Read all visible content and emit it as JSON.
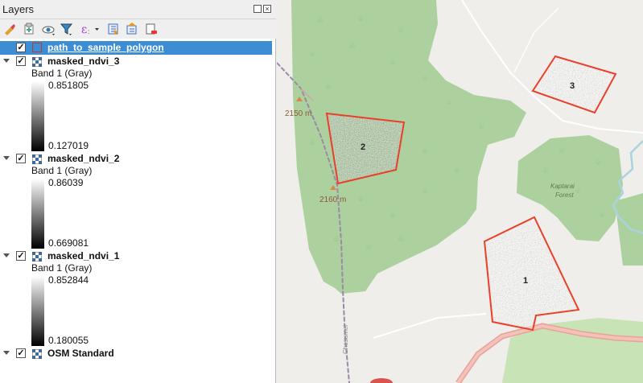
{
  "panel": {
    "title": "Layers",
    "toolbar": [
      "open-layer-styling-icon",
      "add-group-icon",
      "manage-map-themes-icon",
      "filter-legend-icon",
      "filter-by-expression-icon",
      "expand-all-icon",
      "collapse-all-icon",
      "remove-layer-icon"
    ]
  },
  "layers": [
    {
      "name": "path_to_sample_polygon",
      "checked": true,
      "selected": true
    },
    {
      "name": "masked_ndvi_3",
      "checked": true,
      "band": "Band 1 (Gray)",
      "max": "0.851805",
      "min": "0.127019"
    },
    {
      "name": "masked_ndvi_2",
      "checked": true,
      "band": "Band 1 (Gray)",
      "max": "0.86039",
      "min": "0.669081"
    },
    {
      "name": "masked_ndvi_1",
      "checked": true,
      "band": "Band 1 (Gray)",
      "max": "0.852844",
      "min": "0.180055"
    },
    {
      "name": "OSM Standard",
      "checked": true
    }
  ],
  "map": {
    "polygons": [
      {
        "label": "1"
      },
      {
        "label": "2"
      },
      {
        "label": "3"
      }
    ],
    "labels": {
      "elev1": "2150 m",
      "elev2": "2160 m",
      "forest1": "Kaptarai",
      "forest2": "Forest",
      "road": "Chesumei"
    },
    "colors": {
      "forest": "#add19e",
      "background": "#efeeeb",
      "polygon_outline": "#e8402a",
      "road": "#e8a29a"
    }
  }
}
